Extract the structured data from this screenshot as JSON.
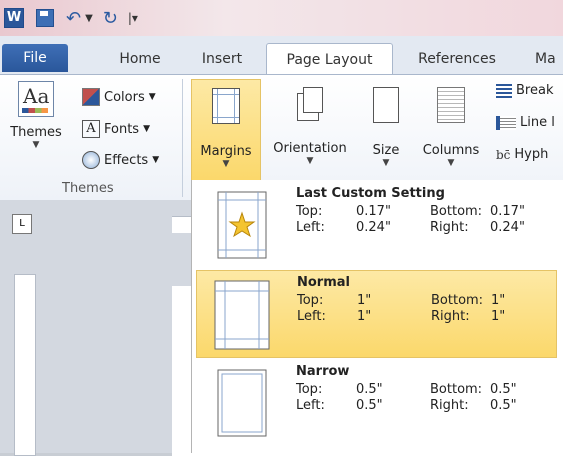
{
  "quick_access": {
    "app_icon_letter": "W"
  },
  "tabs": [
    "File",
    "Home",
    "Insert",
    "Page Layout",
    "References",
    "Ma"
  ],
  "ribbon": {
    "themes_group": {
      "themes_label": "Themes",
      "colors_label": "Colors",
      "fonts_label": "Fonts",
      "effects_label": "Effects",
      "group_label": "Themes"
    },
    "page_setup": {
      "margins_label": "Margins",
      "orientation_label": "Orientation",
      "size_label": "Size",
      "columns_label": "Columns",
      "breaks_label": "Break",
      "line_numbers_label": "Line l",
      "hyphenation_label": "Hyph"
    }
  },
  "margins_menu": [
    {
      "title": "Last Custom Setting",
      "top_label": "Top:",
      "top": "0.17\"",
      "bottom_label": "Bottom:",
      "bottom": "0.17\"",
      "left_label": "Left:",
      "left": "0.24\"",
      "right_label": "Right:",
      "right": "0.24\""
    },
    {
      "title": "Normal",
      "top_label": "Top:",
      "top": "1\"",
      "bottom_label": "Bottom:",
      "bottom": "1\"",
      "left_label": "Left:",
      "left": "1\"",
      "right_label": "Right:",
      "right": "1\""
    },
    {
      "title": "Narrow",
      "top_label": "Top:",
      "top": "0.5\"",
      "bottom_label": "Bottom:",
      "bottom": "0.5\"",
      "left_label": "Left:",
      "left": "0.5\"",
      "right_label": "Right:",
      "right": "0.5\""
    }
  ],
  "colors": {
    "file_tab": "#2b579a",
    "selected_item": "#fbd86b"
  }
}
